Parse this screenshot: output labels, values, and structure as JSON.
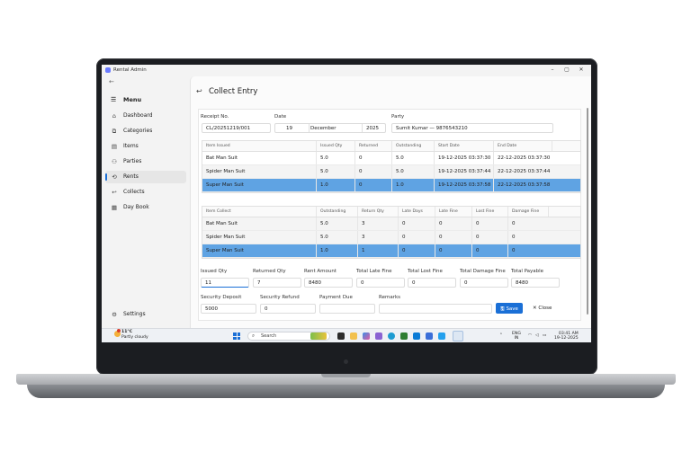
{
  "window": {
    "title": "Rental Admin",
    "min": "–",
    "max": "▢",
    "close": "✕"
  },
  "sidebar": {
    "menu_label": "Menu",
    "items": [
      {
        "label": "Dashboard",
        "icon": "⌂"
      },
      {
        "label": "Categories",
        "icon": "⧉"
      },
      {
        "label": "Items",
        "icon": "▤"
      },
      {
        "label": "Parties",
        "icon": "⚇"
      },
      {
        "label": "Rents",
        "icon": "⟲"
      },
      {
        "label": "Collects",
        "icon": "↩"
      },
      {
        "label": "Day Book",
        "icon": "▦"
      }
    ],
    "settings_label": "Settings",
    "active_index": 4
  },
  "page": {
    "title": "Collect Entry"
  },
  "header_fields": {
    "receipt_label": "Receipt No.",
    "receipt_value": "CL/20251219/001",
    "date_label": "Date",
    "date_day": "19",
    "date_month": "December",
    "date_year": "2025",
    "party_label": "Party",
    "party_value": "Sumit Kumar — 9876543210"
  },
  "issued_table": {
    "columns": [
      "Item Issued",
      "Issued Qty",
      "Returned",
      "Outstanding",
      "Start Date",
      "End Date"
    ],
    "rows": [
      [
        "Bat Man Suit",
        "5.0",
        "0",
        "5.0",
        "19-12-2025 03:37:30",
        "22-12-2025 03:37:30"
      ],
      [
        "Spider Man Suit",
        "5.0",
        "0",
        "5.0",
        "19-12-2025 03:37:44",
        "22-12-2025 03:37:44"
      ],
      [
        "Super Man Suit",
        "1.0",
        "0",
        "1.0",
        "19-12-2025 03:37:58",
        "22-12-2025 03:37:58"
      ]
    ],
    "selected_row": 2
  },
  "collect_table": {
    "columns": [
      "Item Collect",
      "Outstanding",
      "Return Qty",
      "Late Days",
      "Late Fine",
      "Lost Fine",
      "Damage Fine"
    ],
    "rows": [
      [
        "Bat Man Suit",
        "5.0",
        "3",
        "0",
        "0",
        "0",
        "0"
      ],
      [
        "Spider Man Suit",
        "5.0",
        "3",
        "0",
        "0",
        "0",
        "0"
      ],
      [
        "Super Man Suit",
        "1.0",
        "1",
        "0",
        "0",
        "0",
        "0"
      ]
    ],
    "selected_row": 2
  },
  "totals": {
    "issued_qty_label": "Issued Qty",
    "issued_qty": "11",
    "returned_qty_label": "Returned Qty",
    "returned_qty": "7",
    "rent_amount_label": "Rent Amount",
    "rent_amount": "8480",
    "late_fine_label": "Total Late Fine",
    "late_fine": "0",
    "lost_fine_label": "Total Lost Fine",
    "lost_fine": "0",
    "damage_fine_label": "Total Damage Fine",
    "damage_fine": "0",
    "payable_label": "Total Payable",
    "payable": "8480",
    "deposit_label": "Security Deposit",
    "deposit": "5000",
    "refund_label": "Security Refund",
    "refund": "0",
    "payment_due_label": "Payment Due",
    "payment_due": "",
    "remarks_label": "Remarks",
    "remarks": ""
  },
  "buttons": {
    "save": "Save",
    "close": "Close"
  },
  "taskbar": {
    "weather_temp": "11°C",
    "weather_desc": "Partly cloudy",
    "weather_badge": "1",
    "search_placeholder": "Search",
    "lang_1": "ENG",
    "lang_2": "IN",
    "time": "03:41 AM",
    "date": "19-12-2025"
  },
  "colors": {
    "accent": "#1a6fd6",
    "selected_row": "#5fa3e3"
  }
}
